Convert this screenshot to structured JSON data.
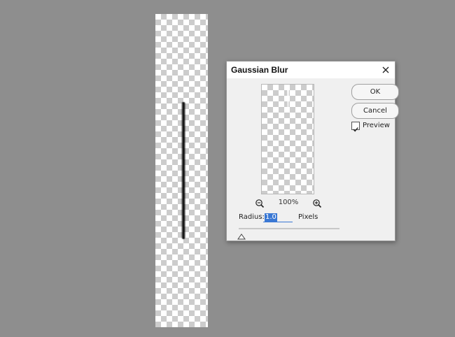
{
  "dialog": {
    "title": "Gaussian Blur",
    "ok_label": "OK",
    "cancel_label": "Cancel",
    "preview_label": "Preview",
    "preview_checked": true,
    "zoom_level": "100%",
    "radius_label": "Radius:",
    "radius_value": "1.0",
    "radius_unit": "Pixels"
  },
  "colors": {
    "workspace": "#8e8e8e",
    "dialog_bg": "#f0f0f0",
    "selection": "#3a78d4"
  },
  "icons": [
    "close-icon",
    "zoom-out-icon",
    "zoom-in-icon",
    "checkmark-icon",
    "slider-thumb"
  ]
}
